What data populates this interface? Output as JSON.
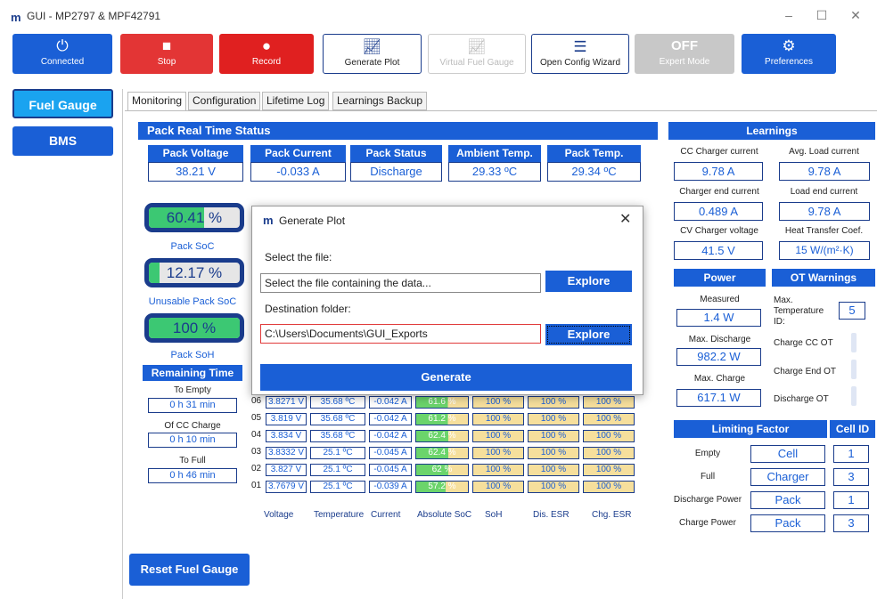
{
  "app": {
    "title": "GUI - MP2797 & MPF42791"
  },
  "toolbar": {
    "connected": "Connected",
    "stop": "Stop",
    "record": "Record",
    "generate_plot": "Generate Plot",
    "virtual_fuel_gauge": "Virtual Fuel Gauge",
    "open_config_wizard": "Open Config Wizard",
    "expert_state": "OFF",
    "expert_mode": "Expert Mode",
    "preferences": "Preferences"
  },
  "sidebar": {
    "items": [
      {
        "label": "Fuel Gauge"
      },
      {
        "label": "BMS"
      }
    ]
  },
  "tabs": [
    {
      "label": "Monitoring"
    },
    {
      "label": "Configuration"
    },
    {
      "label": "Lifetime Log"
    },
    {
      "label": "Learnings Backup"
    }
  ],
  "pack": {
    "title": "Pack Real Time Status",
    "voltage_label": "Pack Voltage",
    "voltage": "38.21 V",
    "current_label": "Pack Current",
    "current": "-0.033 A",
    "status_label": "Pack Status",
    "status": "Discharge",
    "ambient_label": "Ambient Temp.",
    "ambient": "29.33 ºC",
    "temp_label": "Pack Temp.",
    "temp": "29.34 ºC"
  },
  "soc": {
    "value": "60.41 %",
    "label": "Pack SoC",
    "fill": 0.6041
  },
  "unusable": {
    "value": "12.17 %",
    "label": "Unusable Pack SoC",
    "fill": 0.1217
  },
  "soh": {
    "value": "100 %",
    "label": "Pack SoH",
    "fill": 1.0
  },
  "remaining": {
    "title": "Remaining Time",
    "to_empty_label": "To Empty",
    "to_empty": "0 h 31 min",
    "cc_label": "Of CC Charge",
    "cc": "0 h 10 min",
    "full_label": "To Full",
    "full": "0 h 46 min"
  },
  "cells": {
    "rows": [
      {
        "id": "06",
        "voltage": "3.8271 V",
        "temp": "35.68 ºC",
        "current": "-0.042 A",
        "soc": "61.6 %",
        "soh": "100 %",
        "dis": "100 %",
        "chg": "100 %"
      },
      {
        "id": "05",
        "voltage": "3.819 V",
        "temp": "35.68 ºC",
        "current": "-0.042 A",
        "soc": "61.2 %",
        "soh": "100 %",
        "dis": "100 %",
        "chg": "100 %"
      },
      {
        "id": "04",
        "voltage": "3.834 V",
        "temp": "35.68 ºC",
        "current": "-0.042 A",
        "soc": "62.4 %",
        "soh": "100 %",
        "dis": "100 %",
        "chg": "100 %"
      },
      {
        "id": "03",
        "voltage": "3.8332 V",
        "temp": "25.1 ºC",
        "current": "-0.045 A",
        "soc": "62.4 %",
        "soh": "100 %",
        "dis": "100 %",
        "chg": "100 %"
      },
      {
        "id": "02",
        "voltage": "3.827 V",
        "temp": "25.1 ºC",
        "current": "-0.045 A",
        "soc": "62 %",
        "soh": "100 %",
        "dis": "100 %",
        "chg": "100 %"
      },
      {
        "id": "01",
        "voltage": "3.7679 V",
        "temp": "25.1 ºC",
        "current": "-0.039 A",
        "soc": "57.2 %",
        "soh": "100 %",
        "dis": "100 %",
        "chg": "100 %"
      }
    ],
    "headers": [
      "Voltage",
      "Temperature",
      "Current",
      "Absolute SoC",
      "SoH",
      "Dis. ESR",
      "Chg. ESR"
    ]
  },
  "reset_button": "Reset Fuel Gauge",
  "learnings": {
    "title": "Learnings",
    "cc_charger_label": "CC Charger current",
    "cc_charger": "9.78 A",
    "avg_load_label": "Avg. Load current",
    "avg_load": "9.78 A",
    "charger_end_label": "Charger end current",
    "charger_end": "0.489 A",
    "load_end_label": "Load end current",
    "load_end": "9.78 A",
    "cv_label": "CV Charger voltage",
    "cv": "41.5 V",
    "heat_label": "Heat Transfer Coef.",
    "heat": "15 W/(m²·K)"
  },
  "power": {
    "title": "Power",
    "measured_label": "Measured",
    "measured": "1.4 W",
    "max_dis_label": "Max. Discharge",
    "max_dis": "982.2 W",
    "max_chg_label": "Max. Charge",
    "max_chg": "617.1 W"
  },
  "ot": {
    "title": "OT Warnings",
    "max_temp_label": "Max. Temperature ID:",
    "max_temp": "5",
    "charge_cc": "Charge CC OT",
    "charge_end": "Charge End OT",
    "discharge": "Discharge OT"
  },
  "limiting": {
    "title": "Limiting Factor",
    "cell_id": "Cell ID",
    "rows": [
      {
        "label": "Empty",
        "factor": "Cell",
        "id": "1"
      },
      {
        "label": "Full",
        "factor": "Charger",
        "id": "3"
      },
      {
        "label": "Discharge Power",
        "factor": "Pack",
        "id": "1"
      },
      {
        "label": "Charge Power",
        "factor": "Pack",
        "id": "3"
      }
    ]
  },
  "dialog": {
    "title": "Generate Plot",
    "select_label": "Select the file:",
    "file_placeholder": "Select the file containing the data...",
    "explore": "Explore",
    "dest_label": "Destination folder:",
    "dest_value": "C:\\Users\\Documents\\GUI_Exports",
    "generate": "Generate"
  },
  "colors": {
    "accent": "#1a5fd6",
    "dark": "#1a3c8c",
    "red": "#e02020",
    "green": "#3cc873",
    "cell_bg": "#f6df9c"
  }
}
